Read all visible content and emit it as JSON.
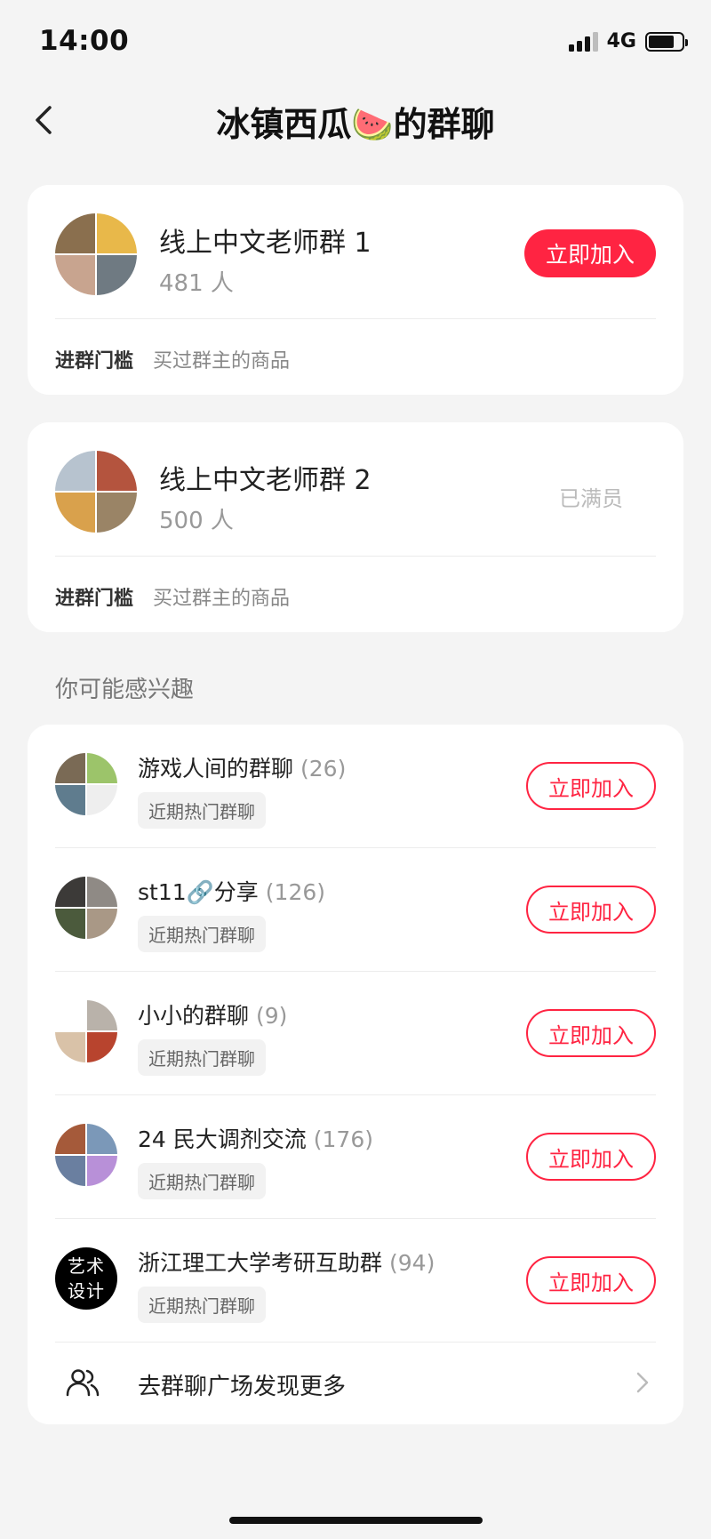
{
  "status": {
    "time": "14:00",
    "network": "4G"
  },
  "nav": {
    "title": "冰镇西瓜🍉的群聊"
  },
  "groups": [
    {
      "name": "线上中文老师群 1",
      "count": "481 人",
      "action": "立即加入",
      "threshold_key": "进群门槛",
      "threshold_value": "买过群主的商品"
    },
    {
      "name": "线上中文老师群 2",
      "count": "500 人",
      "action": "已满员",
      "threshold_key": "进群门槛",
      "threshold_value": "买过群主的商品"
    }
  ],
  "section_title": "你可能感兴趣",
  "recommended": [
    {
      "name": "游戏人间的群聊",
      "count": "(26)",
      "tag": "近期热门群聊",
      "action": "立即加入"
    },
    {
      "name": "st11🔗分享",
      "count": "(126)",
      "tag": "近期热门群聊",
      "action": "立即加入"
    },
    {
      "name": "小小的群聊",
      "count": "(9)",
      "tag": "近期热门群聊",
      "action": "立即加入"
    },
    {
      "name": "24 民大调剂交流",
      "count": "(176)",
      "tag": "近期热门群聊",
      "action": "立即加入"
    },
    {
      "name": "浙江理工大学考研互助群",
      "count": "(94)",
      "tag": "近期热门群聊",
      "action": "立即加入",
      "avatar_text": "艺术设计"
    }
  ],
  "more_link": {
    "label": "去群聊广场发现更多"
  },
  "colors": {
    "accent": "#ff2442",
    "background": "#f4f4f4"
  },
  "icons": {
    "back": "chevron-left-icon",
    "people": "people-icon",
    "more": "chevron-right-icon"
  }
}
